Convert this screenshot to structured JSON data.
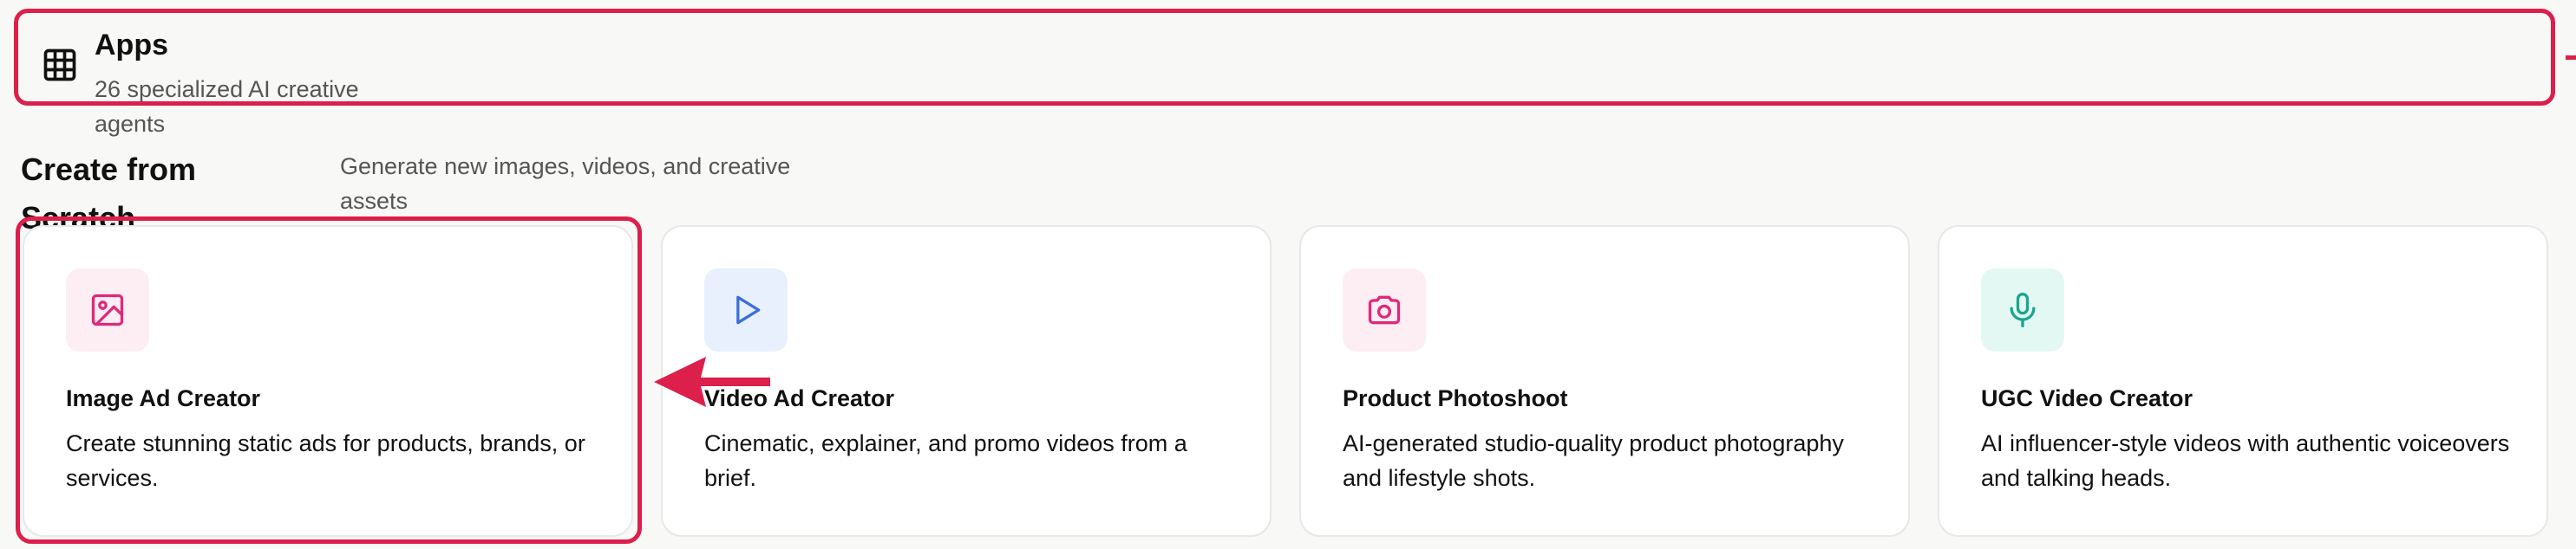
{
  "header": {
    "title": "Apps",
    "subtitle": "26 specialized AI creative agents",
    "icon": "grid-icon"
  },
  "section": {
    "title": "Create from Scratch",
    "subtitle": "Generate new images, videos, and creative assets"
  },
  "cards": [
    {
      "title": "Image Ad Creator",
      "description": "Create stunning static ads for products, brands, or services.",
      "icon": "image-icon",
      "icon_color": "#e0287a",
      "icon_bg": "#fdeef4"
    },
    {
      "title": "Video Ad Creator",
      "description": "Cinematic, explainer, and promo videos from a brief.",
      "icon": "play-icon",
      "icon_color": "#3b6fd6",
      "icon_bg": "#e8f0fd"
    },
    {
      "title": "Product Photoshoot",
      "description": "AI-generated studio-quality product photography and lifestyle shots.",
      "icon": "camera-icon",
      "icon_color": "#e0287a",
      "icon_bg": "#fdeef4"
    },
    {
      "title": "UGC Video Creator",
      "description": "AI influencer-style videos with authentic voiceovers and talking heads.",
      "icon": "microphone-icon",
      "icon_color": "#1aa58f",
      "icon_bg": "#e3f8f3"
    }
  ],
  "colors": {
    "highlight": "#dc1f4b",
    "background": "#f8f8f6"
  }
}
